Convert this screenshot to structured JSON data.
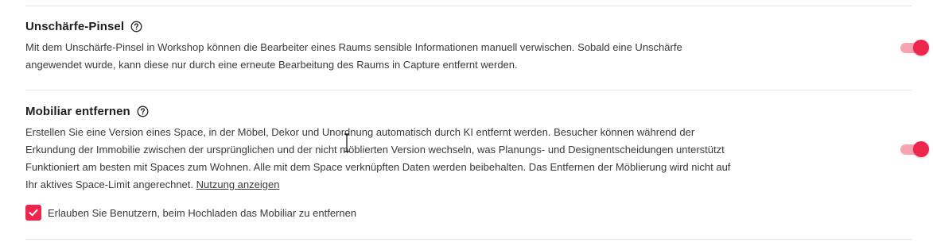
{
  "blur_brush": {
    "title": "Unschärfe-Pinsel",
    "help_icon": "question-circle-icon",
    "description_lines": [
      "Mit dem Unschärfe-Pinsel in Workshop können die Bearbeiter eines Raums sensible Informationen manuell verwischen. Sobald eine Unschärfe",
      "angewendet wurde, kann diese nur durch eine erneute Bearbeitung des Raums in Capture entfernt werden."
    ],
    "toggle_on": true
  },
  "remove_furniture": {
    "title": "Mobiliar entfernen",
    "help_icon": "question-circle-icon",
    "description_lines": [
      "Erstellen Sie eine Version eines Space, in der Möbel, Dekor und Unordnung automatisch durch KI entfernt werden. Besucher können während der",
      "Erkundung der Immobilie zwischen der ursprünglichen und der nicht möblierten Version wechseln, was Planungs- und Designentscheidungen unterstützt",
      "Funktioniert am besten mit Spaces zum Wohnen. Alle mit dem Space verknüpften Daten werden beibehalten. Das Entfernen der Möblierung wird nicht auf",
      "Ihr aktives Space-Limit angerechnet."
    ],
    "link_label": "Nutzung anzeigen",
    "toggle_on": true,
    "checkbox_label": "Erlauben Sie Benutzern, beim Hochladen das Mobiliar zu entfernen",
    "checkbox_checked": true
  },
  "colors": {
    "accent": "#f0254e",
    "toggle_track": "#f7a3b2",
    "divider": "#e6e6e6"
  }
}
